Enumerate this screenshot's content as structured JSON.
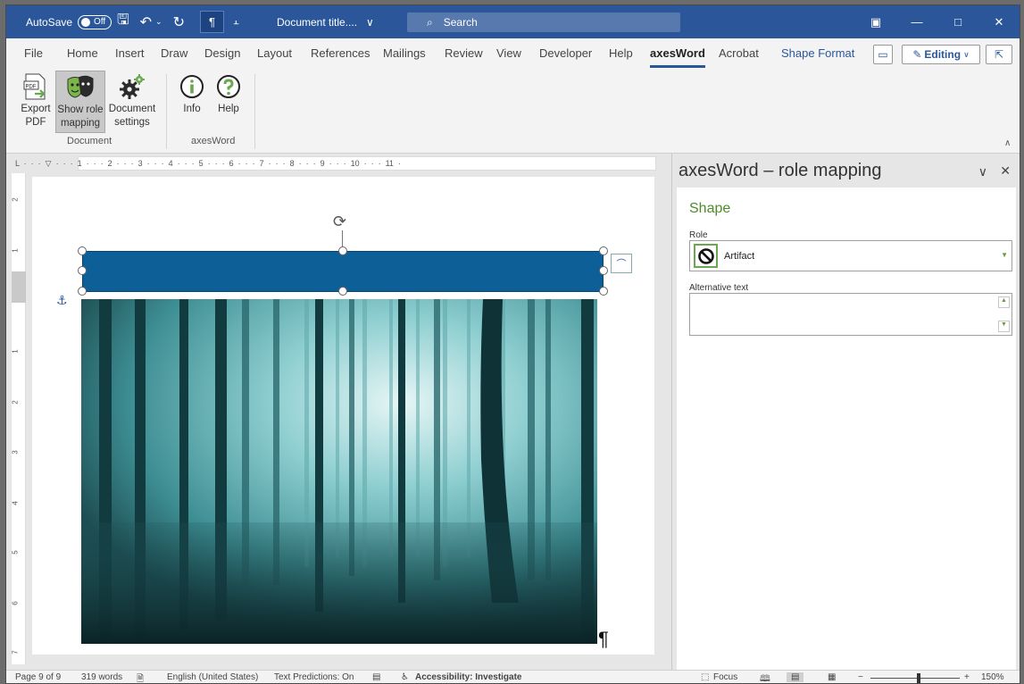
{
  "titlebar": {
    "autosave_label": "AutoSave",
    "autosave_state": "Off",
    "doc_title": "Document title....",
    "search_placeholder": "Search"
  },
  "tabs": [
    "File",
    "Home",
    "Insert",
    "Draw",
    "Design",
    "Layout",
    "References",
    "Mailings",
    "Review",
    "View",
    "Developer",
    "Help",
    "axesWord",
    "Acrobat",
    "Shape Format"
  ],
  "active_tab": "axesWord",
  "editing_label": "Editing",
  "ribbon": {
    "buttons": [
      {
        "line1": "Export",
        "line2": "PDF"
      },
      {
        "line1": "Show role",
        "line2": "mapping"
      },
      {
        "line1": "Document",
        "line2": "settings"
      },
      {
        "line1": "Info",
        "line2": ""
      },
      {
        "line1": "Help",
        "line2": ""
      }
    ],
    "groups": [
      "Document",
      "axesWord"
    ]
  },
  "ruler_text": "L  ·  ·  ·  ▽  ·  ·  ·  1  ·  ·  ·  2  ·  ·  ·  3  ·  ·  ·  4  ·  ·  ·  5  ·  ·  ·  6  ·  ·  ·  7  ·  ·  ·  8  ·  ·  ·  9  ·  ·  ·  10  ·  ·  ·  11  ·",
  "vruler_marks": [
    "2",
    "1",
    "1",
    "2",
    "3",
    "4",
    "5",
    "6",
    "7"
  ],
  "pane": {
    "title": "axesWord – role mapping",
    "section": "Shape",
    "role_label": "Role",
    "role_value": "Artifact",
    "alt_label": "Alternative text",
    "alt_value": ""
  },
  "status": {
    "page": "Page 9 of 9",
    "words": "319 words",
    "language": "English (United States)",
    "predictions": "Text Predictions: On",
    "accessibility": "Accessibility: Investigate",
    "focus": "Focus",
    "zoom": "150%"
  },
  "colors": {
    "titlebar": "#2b579a",
    "shape": "#0d5f97",
    "pane_heading": "#4c8c2b"
  }
}
